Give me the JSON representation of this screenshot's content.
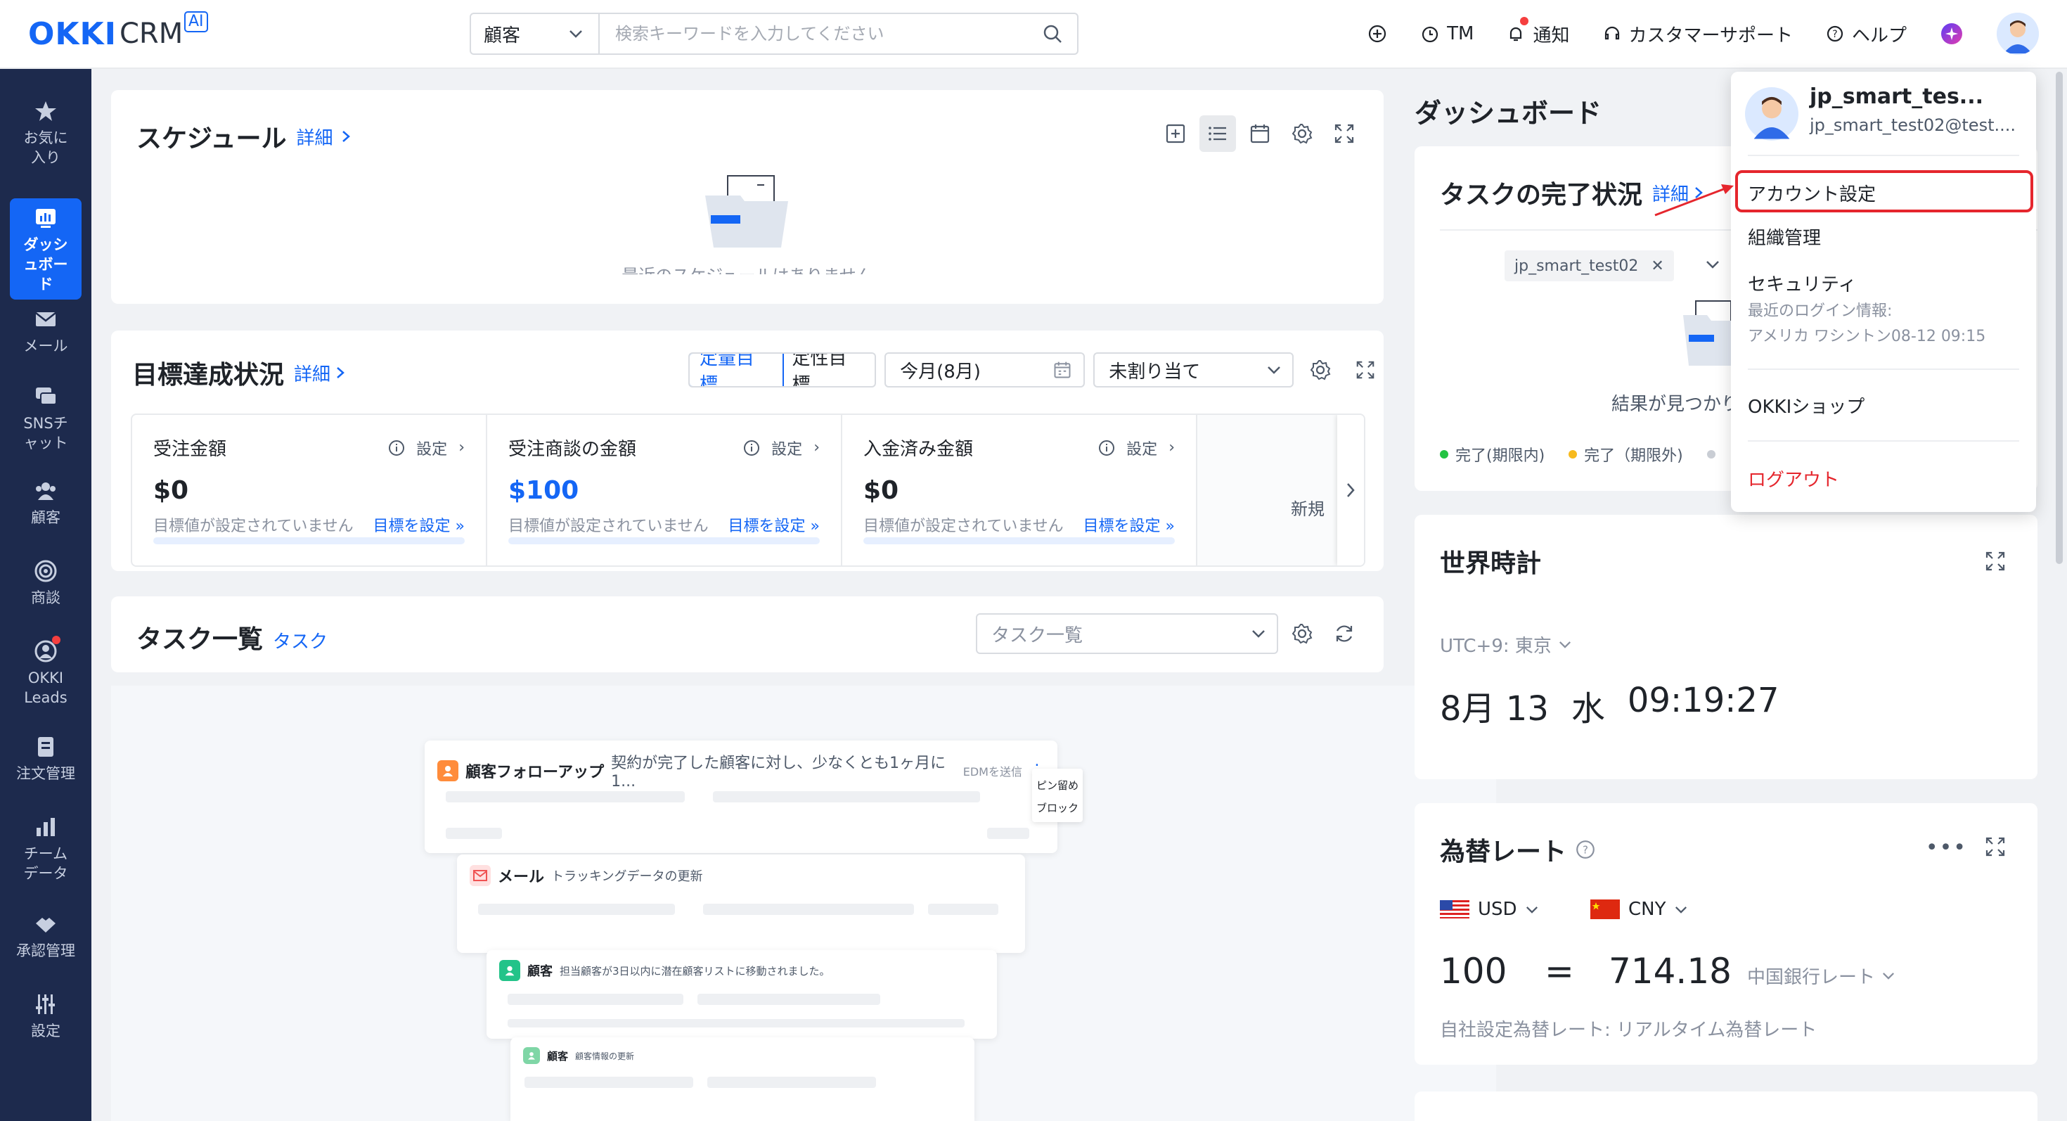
{
  "header": {
    "logo_main": "OKKI",
    "logo_sub": "CRM",
    "logo_badge": "AI",
    "search_scope": "顧客",
    "search_placeholder": "検索キーワードを入力してください",
    "nav": {
      "tm": "TM",
      "notice": "通知",
      "support": "カスタマーサポート",
      "help": "ヘルプ"
    }
  },
  "sidebar": {
    "items": [
      {
        "label": "お気に入り",
        "icon": "star-icon"
      },
      {
        "label": "ダッシュボード",
        "icon": "dashboard-icon"
      },
      {
        "label": "メール",
        "icon": "mail-icon"
      },
      {
        "label": "SNSチャット",
        "icon": "chat-icon"
      },
      {
        "label": "顧客",
        "icon": "customers-icon"
      },
      {
        "label": "商談",
        "icon": "target-icon"
      },
      {
        "label": "OKKI Leads",
        "icon": "leads-icon"
      },
      {
        "label": "注文管理",
        "icon": "order-icon"
      },
      {
        "label": "チームデータ",
        "icon": "chart-icon"
      },
      {
        "label": "承認管理",
        "icon": "approval-icon"
      },
      {
        "label": "設定",
        "icon": "settings-icon"
      }
    ]
  },
  "schedule": {
    "title": "スケジュール",
    "detail": "詳細",
    "empty": "最近のスケジュールはありません"
  },
  "goals": {
    "title": "目標達成状況",
    "detail": "詳細",
    "seg_quant": "定量目標",
    "seg_qual": "定性目標",
    "period": "今月(8月)",
    "assign": "未割り当て",
    "cards": [
      {
        "name": "受注金額",
        "set": "設定",
        "value": "$0",
        "note": "目標値が設定されていません",
        "link": "目標を設定 »",
        "progress": 0
      },
      {
        "name": "受注商談の金額",
        "set": "設定",
        "value": "$100",
        "note": "目標値が設定されていません",
        "link": "目標を設定 »",
        "progress": 0
      },
      {
        "name": "入金済み金額",
        "set": "設定",
        "value": "$0",
        "note": "目標値が設定されていません",
        "link": "目標を設定 »",
        "progress": 0
      }
    ],
    "new_label": "新規"
  },
  "tasks": {
    "title": "タスク一覧",
    "sub": "タスク",
    "select": "タスク一覧",
    "cards": [
      {
        "type": "顧客フォローアップ",
        "desc": "契約が完了した顧客に対し、少なくとも1ヶ月に1...",
        "tag": "EDMを送信"
      },
      {
        "type": "メール",
        "desc": "トラッキングデータの更新"
      },
      {
        "type": "顧客",
        "desc": "担当顧客が3日以内に潜在顧客リストに移動されました。"
      },
      {
        "type": "顧客",
        "desc": "顧客情報の更新"
      }
    ],
    "menu": [
      "ピン留め",
      "ブロック"
    ]
  },
  "dashboard": {
    "title": "ダッシュボード",
    "task_status": {
      "title": "タスクの完了状況",
      "detail": "詳細",
      "filter": "jp_smart_test02",
      "empty": "結果が見つかりません",
      "legend": [
        {
          "label": "完了(期限内)",
          "color": "#23c343"
        },
        {
          "label": "完了（期限外)",
          "color": "#f7ba1e"
        }
      ]
    },
    "world_clock": {
      "title": "世界時計",
      "zone": "UTC+9: 東京",
      "date": "8月 13",
      "weekday": "水",
      "time": "09:19:27"
    },
    "fx": {
      "title": "為替レート",
      "from": "USD",
      "to": "CNY",
      "amount": "100",
      "eq": "=",
      "result": "714.18",
      "source": "中国銀行レート",
      "note": "自社設定為替レート: リアルタイム為替レート"
    }
  },
  "account_menu": {
    "name": "jp_smart_tes...",
    "email": "jp_smart_test02@test....",
    "account_settings": "アカウント設定",
    "org": "組織管理",
    "security": "セキュリティ",
    "last_login_label": "最近のログイン情報:",
    "last_login_value": "アメリカ ワシントン08-12 09:15",
    "shop": "OKKIショップ",
    "logout": "ログアウト"
  }
}
